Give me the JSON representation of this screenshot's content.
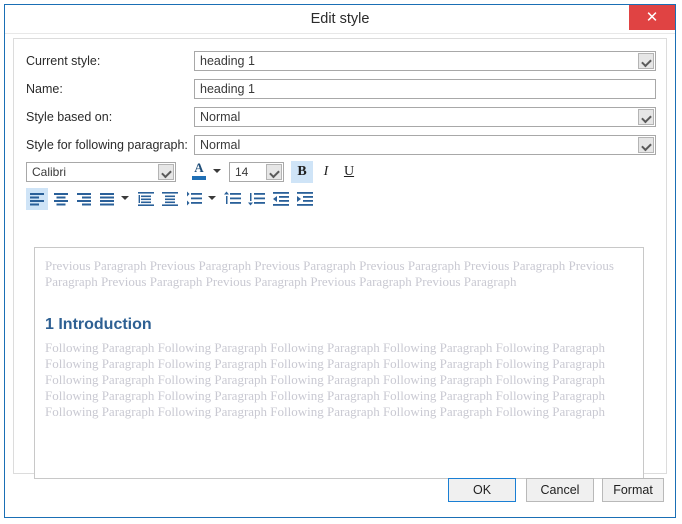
{
  "window": {
    "title": "Edit style",
    "close_label": "✕",
    "close_icon": "close-icon",
    "accent_color": "#1a6fb5",
    "close_color": "#e04343"
  },
  "fields": [
    {
      "label": "Current style:",
      "value": "heading 1",
      "type": "combobox"
    },
    {
      "label": "Name:",
      "value": "heading 1",
      "type": "text"
    },
    {
      "label": "Style based on:",
      "value": "Normal",
      "type": "combobox"
    },
    {
      "label": "Style for following paragraph:",
      "value": "Normal",
      "type": "combobox"
    }
  ],
  "format_toolbar": {
    "font_name": "Calibri",
    "font_size": "14",
    "font_color_icon": "font-color-icon",
    "bold_label": "B",
    "italic_label": "I",
    "underline_label": "U",
    "bold_active": true,
    "italic_active": false,
    "underline_active": false
  },
  "paragraph_toolbar": {
    "buttons": [
      {
        "name": "align-left-icon",
        "active": true
      },
      {
        "name": "align-center-icon",
        "active": false
      },
      {
        "name": "align-right-icon",
        "active": false
      },
      {
        "name": "align-justify-icon",
        "active": false
      },
      {
        "name": "line-spacing-icon",
        "active": false
      },
      {
        "name": "paragraph-spacing-icon",
        "active": false
      },
      {
        "name": "bullet-list-icon",
        "active": false
      },
      {
        "name": "spacing-before-icon",
        "active": false
      },
      {
        "name": "spacing-after-icon",
        "active": false
      },
      {
        "name": "decrease-indent-icon",
        "active": false
      },
      {
        "name": "increase-indent-icon",
        "active": false
      }
    ]
  },
  "preview": {
    "previous_paragraph": "Previous Paragraph Previous Paragraph Previous Paragraph Previous Paragraph Previous Paragraph Previous Paragraph Previous Paragraph Previous Paragraph Previous Paragraph Previous Paragraph",
    "heading_sample": "1 Introduction",
    "following_paragraph": "Following Paragraph Following Paragraph Following Paragraph Following Paragraph Following Paragraph Following Paragraph Following Paragraph Following Paragraph Following Paragraph Following Paragraph Following Paragraph Following Paragraph Following Paragraph Following Paragraph Following Paragraph Following Paragraph Following Paragraph Following Paragraph Following Paragraph Following Paragraph Following Paragraph Following Paragraph Following Paragraph Following Paragraph Following Paragraph",
    "heading_color": "#2e6093",
    "body_color": "#c9c9d2"
  },
  "footer": {
    "ok_label": "OK",
    "cancel_label": "Cancel",
    "format_label": "Format"
  }
}
